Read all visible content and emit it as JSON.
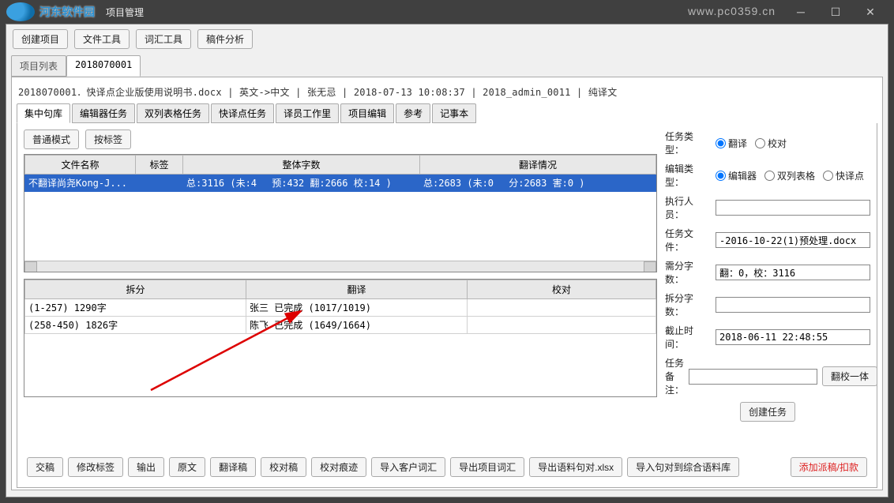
{
  "window": {
    "logo_text": "河东软件园",
    "title": "项目管理",
    "watermark": "www.pc0359.cn"
  },
  "toolbar": {
    "create_project": "创建项目",
    "file_tools": "文件工具",
    "vocab_tools": "词汇工具",
    "doc_analysis": "稿件分析"
  },
  "main_tabs": {
    "project_list": "项目列表",
    "project_id": "2018070001"
  },
  "file_header": "2018070001．快译点企业版使用说明书.docx  |  英文->中文  |  张无忌  |  2018-07-13 10:08:37  |  2018_admin_0011  |  纯译文",
  "sub_tabs": [
    "集中句库",
    "编辑器任务",
    "双列表格任务",
    "快译点任务",
    "译员工作里",
    "项目编辑",
    "参考",
    "记事本"
  ],
  "mode_buttons": {
    "normal": "普通模式",
    "by_tag": "按标签"
  },
  "upper_table": {
    "headers": [
      "文件名称",
      "标签",
      "整体字数",
      "翻译情况"
    ],
    "row": {
      "filename": "不翻译尚尧Kong-J...",
      "tag": "",
      "wordcount": "总:3116 (未:4　 预:432  翻:2666 校:14  )",
      "status": "总:2683 (未:0　 分:2683 害:0  )"
    }
  },
  "lower_table": {
    "headers": [
      "拆分",
      "翻译",
      "校对"
    ],
    "rows": [
      {
        "split": "(1-257) 1290字",
        "translate": "张三 已完成 (1017/1019)",
        "review": ""
      },
      {
        "split": "(258-450) 1826字",
        "translate": "陈飞 已完成 (1649/1664)",
        "review": ""
      }
    ]
  },
  "form": {
    "task_type_label": "任务类型：",
    "task_type_opts": [
      "翻译",
      "校对"
    ],
    "edit_type_label": "编辑类型：",
    "edit_type_opts": [
      "编辑器",
      "双列表格",
      "快译点"
    ],
    "executor_label": "执行人员：",
    "executor_value": "",
    "task_file_label": "任务文件：",
    "task_file_value": "-2016-10-22(1)预处理.docx",
    "need_words_label": "需分字数：",
    "need_words_value": "翻：0，校：3116",
    "split_words_label": "拆分字数：",
    "split_words_value": "",
    "deadline_label": "截止时间：",
    "deadline_value": "2018-06-11 22:48:55",
    "remark_label": "任务备注：",
    "remark_value": "",
    "trans_review_btn": "翻校一体",
    "create_task_btn": "创建任务"
  },
  "bottom_buttons": [
    "交稿",
    "修改标签",
    "输出",
    "原文",
    "翻译稿",
    "校对稿",
    "校对痕迹",
    "导入客户词汇",
    "导出项目词汇",
    "导出语料句对.xlsx",
    "导入句对到综合语料库"
  ],
  "bottom_right_btn": "添加派稿/扣款"
}
